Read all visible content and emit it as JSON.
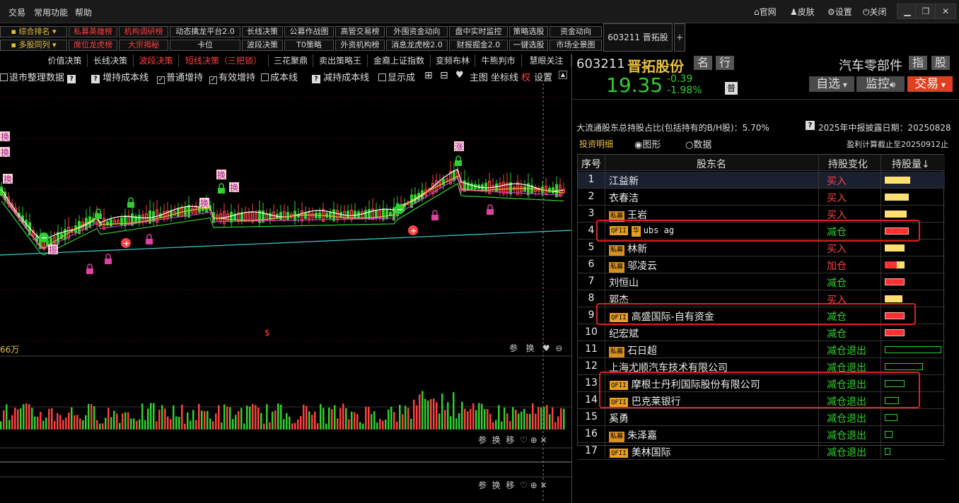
{
  "menu": [
    "交易",
    "常用功能",
    "帮助"
  ],
  "top_right": {
    "official": "官网",
    "skin": "皮肤",
    "settings": "设置",
    "close": "关闭"
  },
  "nav_row1": [
    {
      "label": "综合排名",
      "color": "yellow",
      "dd": true
    },
    {
      "label": "私募英雄榜",
      "color": "red"
    },
    {
      "label": "机构调研榜",
      "color": "red"
    },
    {
      "label": "动态擒龙平台2.0",
      "color": "white"
    },
    {
      "label": "长线决策",
      "color": "white"
    },
    {
      "label": "公募作战图",
      "color": "white"
    },
    {
      "label": "高管交易榜",
      "color": "white"
    },
    {
      "label": "外围资金动向",
      "color": "white"
    },
    {
      "label": "盘中实时监控",
      "color": "white"
    },
    {
      "label": "策略选股",
      "color": "white"
    },
    {
      "label": "资金动向",
      "color": "white"
    }
  ],
  "nav_row2": [
    {
      "label": "多股同列",
      "color": "yellow",
      "dd": true
    },
    {
      "label": "席位龙虎榜",
      "color": "red"
    },
    {
      "label": "大宗揭秘",
      "color": "red"
    },
    {
      "label": "卡位",
      "color": "white"
    },
    {
      "label": "波段决策",
      "color": "white"
    },
    {
      "label": "T0策略",
      "color": "white"
    },
    {
      "label": "外资机构榜",
      "color": "white"
    },
    {
      "label": "消息龙虎榜2.0",
      "color": "white"
    },
    {
      "label": "财报掘金2.0",
      "color": "white"
    },
    {
      "label": "一键选股",
      "color": "white"
    },
    {
      "label": "市场全景图",
      "color": "white"
    }
  ],
  "stock_tag": "603211 晋拓股份",
  "plus": "+",
  "tabs": [
    "价值决策",
    "长线决策",
    "波段决策",
    "短线决策（三把锁）",
    "三花聚鼎",
    "卖出策略王",
    "金裔上证指数",
    "变频布林",
    "牛熊判市",
    "慧眼关注"
  ],
  "chart_options": {
    "delist": "退市整理数据",
    "increase_cost": "增持成本线",
    "normal_increase": "普通增持",
    "effective_increase": "有效增持",
    "cost_line": "成本线",
    "decrease_cost": "减持成本线",
    "show": "显示成",
    "main": "主图",
    "coord": "坐标线",
    "quan": "权",
    "settings": "设置"
  },
  "chart_signals": {
    "huan": "换",
    "zhang": "涨",
    "zhen": "振",
    "dollar": "$",
    "vol_label": "66万"
  },
  "sub_tools": {
    "can": "参",
    "huan": "换",
    "yi": "移"
  },
  "stock": {
    "code": "603211",
    "name": "晋拓股份",
    "tag1": "名",
    "tag2": "行",
    "industry": "汽车零部件",
    "tag3": "指",
    "tag4": "股",
    "price": "19.35",
    "change": "-0.39",
    "pct": "-1.98%",
    "pu": "普"
  },
  "actions": {
    "select": "自选",
    "monitor": "监控",
    "trade": "交易"
  },
  "holding_info": {
    "ratio_text": "大流通股东总持股占比(包括持有的B/H股)：5.70%",
    "date_text": "2025年中报披露日期：20250828",
    "profit_text": "盈利计算截止至20250912止"
  },
  "detail_tabs": {
    "title": "投资明细",
    "graph": "图形",
    "data": "数据"
  },
  "table": {
    "headers": [
      "序号",
      "股东名",
      "持股变化",
      "持股量↓"
    ],
    "rows": [
      {
        "idx": "1",
        "name": "江益新",
        "tag": "",
        "change": "买入",
        "cc": "#ff4040",
        "bar": 0.44,
        "bc": "#ffe070",
        "outline": false
      },
      {
        "idx": "2",
        "name": "衣春洁",
        "tag": "",
        "change": "买入",
        "cc": "#ff4040",
        "bar": 0.42,
        "bc": "#ffe070",
        "outline": false
      },
      {
        "idx": "3",
        "name": "王岩",
        "tag": "私募",
        "change": "买入",
        "cc": "#ff4040",
        "bar": 0.38,
        "bc": "#ffe070",
        "outline": false
      },
      {
        "idx": "4",
        "name": "ubs ag",
        "tag": "QFII|华",
        "change": "减仓",
        "cc": "#30d030",
        "bar": 0.42,
        "bc": "#ff3030",
        "outline": true
      },
      {
        "idx": "5",
        "name": "林新",
        "tag": "私募",
        "change": "买入",
        "cc": "#ff4040",
        "bar": 0.34,
        "bc": "#ffe070",
        "outline": false
      },
      {
        "idx": "6",
        "name": "邬凌云",
        "tag": "私募",
        "change": "加仓",
        "cc": "#ff4040",
        "bar": 0.34,
        "bc": "#ff3030",
        "outline": false
      },
      {
        "idx": "7",
        "name": "刘恒山",
        "tag": "",
        "change": "减仓",
        "cc": "#30d030",
        "bar": 0.34,
        "bc": "#ff3030",
        "outline": true
      },
      {
        "idx": "8",
        "name": "郭杰",
        "tag": "",
        "change": "买入",
        "cc": "#ff4040",
        "bar": 0.3,
        "bc": "#ffe070",
        "outline": false
      },
      {
        "idx": "9",
        "name": "高盛国际-自有资金",
        "tag": "QFII",
        "change": "减仓",
        "cc": "#30d030",
        "bar": 0.34,
        "bc": "#ff3030",
        "outline": true
      },
      {
        "idx": "10",
        "name": "纪宏斌",
        "tag": "",
        "change": "减仓",
        "cc": "#30d030",
        "bar": 0.34,
        "bc": "#ff3030",
        "outline": true
      },
      {
        "idx": "11",
        "name": "石日超",
        "tag": "私募",
        "change": "减仓退出",
        "cc": "#30d030",
        "bar": 0.98,
        "bc": "none",
        "outline": true
      },
      {
        "idx": "12",
        "name": "上海尤顺汽车技术有限公司",
        "tag": "",
        "change": "减仓退出",
        "cc": "#30d030",
        "bar": 0.66,
        "bc": "none",
        "outline": true
      },
      {
        "idx": "13",
        "name": "摩根士丹利国际股份有限公司",
        "tag": "QFII",
        "change": "减仓退出",
        "cc": "#30d030",
        "bar": 0.34,
        "bc": "none",
        "outline": true
      },
      {
        "idx": "14",
        "name": "巴克莱银行",
        "tag": "QFII",
        "change": "减仓退出",
        "cc": "#30d030",
        "bar": 0.24,
        "bc": "none",
        "outline": true
      },
      {
        "idx": "15",
        "name": "奚勇",
        "tag": "",
        "change": "减仓退出",
        "cc": "#30d030",
        "bar": 0.22,
        "bc": "none",
        "outline": true
      },
      {
        "idx": "16",
        "name": "朱泽嘉",
        "tag": "私募",
        "change": "减仓退出",
        "cc": "#30d030",
        "bar": 0.14,
        "bc": "none",
        "outline": true
      },
      {
        "idx": "17",
        "name": "美林国际",
        "tag": "QFII",
        "change": "减仓退出",
        "cc": "#30d030",
        "bar": 0.1,
        "bc": "none",
        "outline": true
      }
    ]
  },
  "colors": {
    "up": "#ff4040",
    "down": "#30d030",
    "accent": "#e8c040",
    "highlight": "#e02020"
  }
}
